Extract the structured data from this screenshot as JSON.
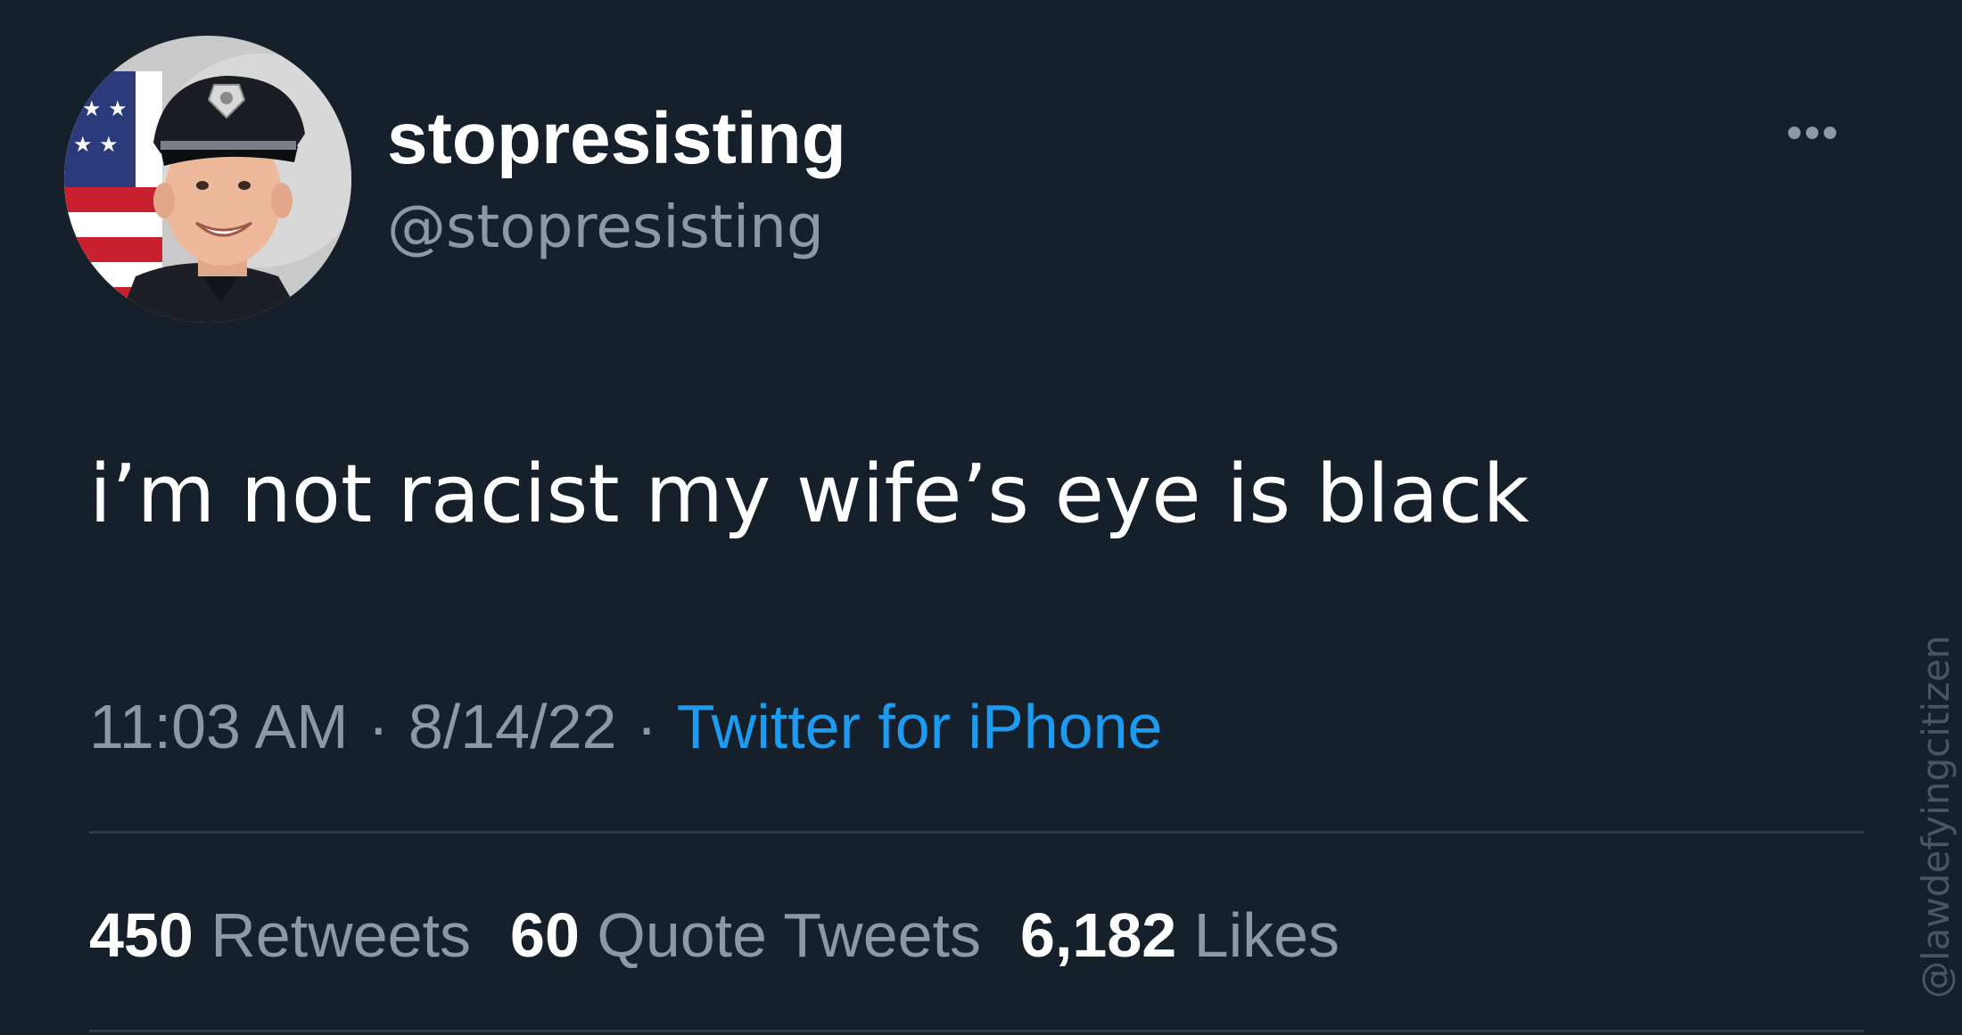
{
  "user": {
    "display_name": "stopresisting",
    "handle": "@stopresisting",
    "avatar_icon": "police-officer-avatar"
  },
  "more_icon": "more-options-icon",
  "tweet": {
    "text": "i’m not racist my wife’s eye is black",
    "time": "11:03 AM",
    "separator": "·",
    "date": "8/14/22",
    "source": "Twitter for iPhone"
  },
  "stats": {
    "retweets_count": "450",
    "retweets_label": "Retweets",
    "quotes_count": "60",
    "quotes_label": "Quote Tweets",
    "likes_count": "6,182",
    "likes_label": "Likes"
  },
  "watermark": "@lawdefyingcitizen",
  "colors": {
    "background": "#15202b",
    "text_primary": "#ffffff",
    "text_secondary": "#8b98a5",
    "accent": "#1d9bf0"
  }
}
